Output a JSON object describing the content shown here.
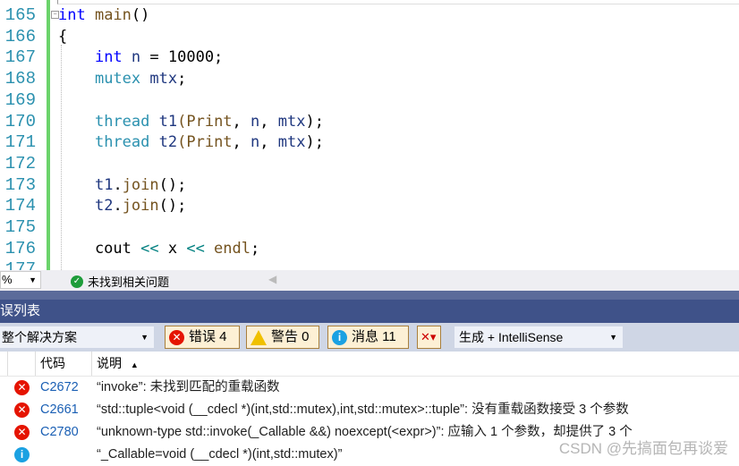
{
  "editor": {
    "lines": [
      {
        "num": "165",
        "tokens": [
          [
            "kw",
            "int"
          ],
          [
            "",
            ""
          ],
          [
            "fn",
            " main"
          ],
          [
            "",
            "()"
          ]
        ]
      },
      {
        "num": "166",
        "tokens": [
          [
            "",
            "{"
          ]
        ]
      },
      {
        "num": "167",
        "tokens": [
          [
            "",
            "    "
          ],
          [
            "kw",
            "int"
          ],
          [
            "",
            " "
          ],
          [
            "id",
            "n"
          ],
          [
            "",
            " = 10000;"
          ]
        ]
      },
      {
        "num": "168",
        "tokens": [
          [
            "",
            "    "
          ],
          [
            "ty",
            "mutex"
          ],
          [
            "",
            " "
          ],
          [
            "id",
            "mtx"
          ],
          [
            "",
            ";"
          ]
        ]
      },
      {
        "num": "169",
        "tokens": []
      },
      {
        "num": "170",
        "tokens": [
          [
            "",
            "    "
          ],
          [
            "ty",
            "thread"
          ],
          [
            "",
            " "
          ],
          [
            "id",
            "t1"
          ],
          [
            "fn",
            "("
          ],
          [
            "fn",
            "Print"
          ],
          [
            "",
            ", "
          ],
          [
            "id",
            "n"
          ],
          [
            "",
            ", "
          ],
          [
            "id",
            "mtx"
          ],
          [
            "",
            ");"
          ]
        ]
      },
      {
        "num": "171",
        "tokens": [
          [
            "",
            "    "
          ],
          [
            "ty",
            "thread"
          ],
          [
            "",
            " "
          ],
          [
            "id",
            "t2"
          ],
          [
            "fn",
            "("
          ],
          [
            "fn",
            "Print"
          ],
          [
            "",
            ", "
          ],
          [
            "id",
            "n"
          ],
          [
            "",
            ", "
          ],
          [
            "id",
            "mtx"
          ],
          [
            "",
            ");"
          ]
        ]
      },
      {
        "num": "172",
        "tokens": []
      },
      {
        "num": "173",
        "tokens": [
          [
            "",
            "    "
          ],
          [
            "id",
            "t1"
          ],
          [
            "",
            "."
          ],
          [
            "fn",
            "join"
          ],
          [
            "",
            "();"
          ]
        ]
      },
      {
        "num": "174",
        "tokens": [
          [
            "",
            "    "
          ],
          [
            "id",
            "t2"
          ],
          [
            "",
            "."
          ],
          [
            "fn",
            "join"
          ],
          [
            "",
            "();"
          ]
        ]
      },
      {
        "num": "175",
        "tokens": []
      },
      {
        "num": "176",
        "tokens": [
          [
            "",
            "    cout "
          ],
          [
            "op",
            "<<"
          ],
          [
            "",
            " x "
          ],
          [
            "op",
            "<<"
          ],
          [
            "fn",
            " endl"
          ],
          [
            "",
            ";"
          ]
        ]
      },
      {
        "num": "177",
        "tokens": []
      }
    ]
  },
  "status": {
    "zoom": "%",
    "issues": "未找到相关问题"
  },
  "panel": {
    "title": "误列表",
    "scope": "整个解决方案",
    "errors": "错误 4",
    "warnings": "警告 0",
    "messages": "消息 11",
    "source": "生成 + IntelliSense"
  },
  "columns": {
    "code": "代码",
    "desc": "说明"
  },
  "rows": [
    {
      "type": "error",
      "code": "C2672",
      "desc": "“invoke”: 未找到匹配的重载函数"
    },
    {
      "type": "error",
      "code": "C2661",
      "desc": "“std::tuple<void (__cdecl *)(int,std::mutex),int,std::mutex>::tuple”: 没有重载函数接受 3 个参数"
    },
    {
      "type": "error",
      "code": "C2780",
      "desc": "“unknown-type std::invoke(_Callable &&) noexcept(<expr>)”: 应输入 1 个参数，却提供了 3 个"
    },
    {
      "type": "info",
      "code": "",
      "desc": "“_Callable=void (__cdecl *)(int,std::mutex)”"
    }
  ],
  "watermark": "CSDN @先搞面包再谈爱"
}
